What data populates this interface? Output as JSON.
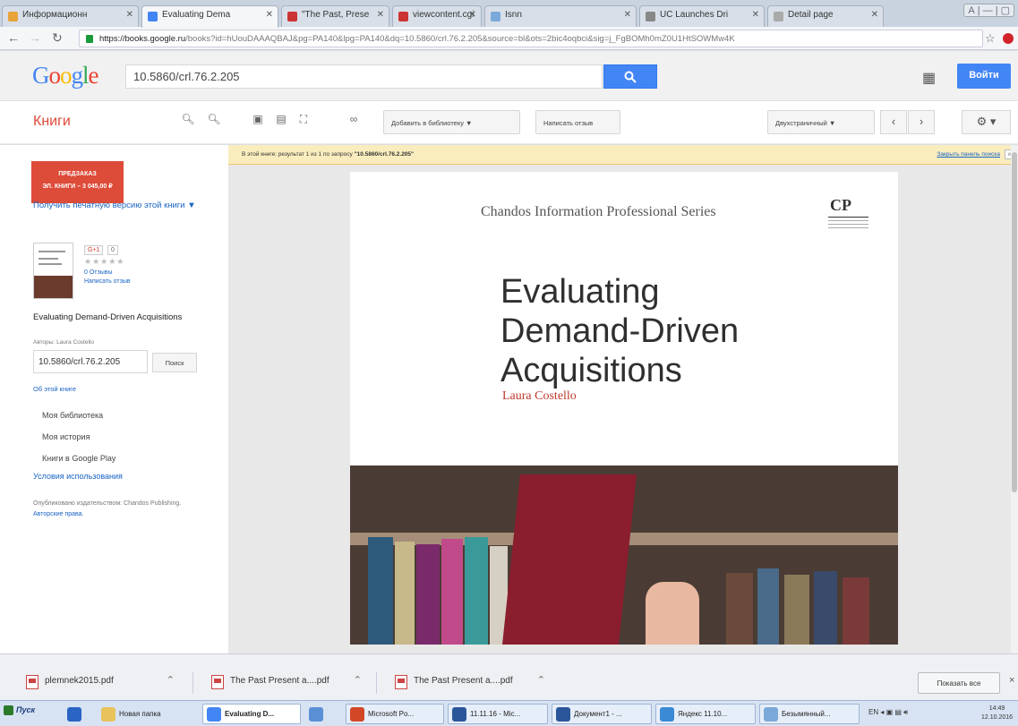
{
  "tabs": [
    {
      "label": "Информационн",
      "color": "#e8a33a"
    },
    {
      "label": "Evaluating Dema",
      "color": "#4285f4"
    },
    {
      "label": "\"The Past, Prese",
      "color": "#cc3333"
    },
    {
      "label": "viewcontent.cgi",
      "color": "#cc3333"
    },
    {
      "label": "Isnn",
      "color": "#7aa9d9"
    },
    {
      "label": "UC Launches Dri",
      "color": "#888888"
    },
    {
      "label": "Detail page",
      "color": "#aaaaaa"
    }
  ],
  "window_buttons": "А | — | ▢",
  "address": {
    "url_host": "https://books.google.ru",
    "url_path": "/books?id=hUouDAAAQBAJ&pg=PA140&lpg=PA140&dq=10.5860/crl.76.2.205&source=bl&ots=2bic4oqbci&sig=j_FgBOMh0mZ0U1HtSOWMw4K"
  },
  "google": {
    "logo": [
      {
        "ch": "G",
        "color": "#4285f4"
      },
      {
        "ch": "o",
        "color": "#ea4335"
      },
      {
        "ch": "o",
        "color": "#fbbc05"
      },
      {
        "ch": "g",
        "color": "#4285f4"
      },
      {
        "ch": "l",
        "color": "#34a853"
      },
      {
        "ch": "e",
        "color": "#ea4335"
      }
    ],
    "query": "10.5860/crl.76.2.205",
    "signin_label": "Войти"
  },
  "books_toolbar": {
    "title": "Книги",
    "add_library": "Добавить в библиотеку ▼",
    "write_review": "Написать отзыв",
    "view_mode": "Двухстраничный ▼"
  },
  "sidebar": {
    "preorder_line1": "ПРЕДЗАКАЗ",
    "preorder_line2": "ЭЛ. КНИГИ – 3 045,00 ₽",
    "print_link": "Получить печатную версию этой книги ▼",
    "gplus": "G+1",
    "gcount": "0",
    "stars": "★★★★★",
    "reviews_count": "0 Отзывы",
    "write_review": "Написать отзыв",
    "book_title": "Evaluating Demand-Driven Acquisitions",
    "authors": "Авторы: Laura Costello",
    "inbook_query": "10.5860/crl.76.2.205",
    "inbook_button": "Поиск",
    "about": "Об этой книге",
    "nav": [
      "Моя библиотека",
      "Моя история",
      "Книги в Google Play"
    ],
    "terms": "Условия использования",
    "publisher_text": "Опубликовано издательством: Chandos Publishing.",
    "copyright_link": "Авторские права."
  },
  "notice": {
    "prefix": "В этой книге: результат 1 из 1 по запросу",
    "query": "\"10.5860/crl.76.2.205\"",
    "close_search": "Закрыть панель поиска"
  },
  "cover": {
    "series": "Chandos Information Professional Series",
    "publisher_mark": "CP",
    "title_lines": [
      "Evaluating",
      "Demand-Driven",
      "Acquisitions"
    ],
    "author": "Laura Costello"
  },
  "downloads": {
    "items": [
      "plemnek2015.pdf",
      "The Past Present a....pdf",
      "The Past Present a....pdf"
    ],
    "show_all": "Показать все"
  },
  "taskbar": {
    "start": "Пуск",
    "items": [
      {
        "label": "",
        "color": "#2a64c4"
      },
      {
        "label": "Новая папка",
        "color": "#e8c25a"
      },
      {
        "label": "Evaluating D...",
        "color": "#4285f4"
      },
      {
        "label": "",
        "color": "#5a8fd6"
      },
      {
        "label": "Microsoft Po...",
        "color": "#d24726"
      },
      {
        "label": "11.11.16 - Mic...",
        "color": "#2b579a"
      },
      {
        "label": "Документ1 - ...",
        "color": "#2b579a"
      },
      {
        "label": "Яндекс 11.10...",
        "color": "#3a8ad6"
      },
      {
        "label": "Безымянный...",
        "color": "#7aa9d9"
      }
    ],
    "lang": "EN",
    "time": "14:49",
    "date": "12.10.2016"
  }
}
